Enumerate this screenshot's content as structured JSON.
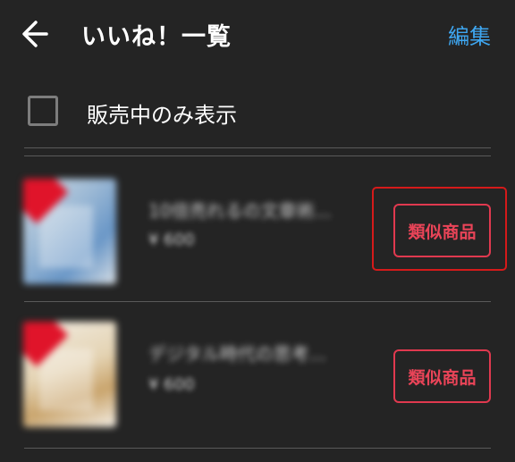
{
  "header": {
    "back_icon": "arrow-left-icon",
    "title": "いいね！一覧",
    "edit_label": "編集",
    "edit_color": "#3ea6f0"
  },
  "filter": {
    "checked": false,
    "label": "販売中のみ表示"
  },
  "items": [
    {
      "title": "10倍売れるの文章術...",
      "price": "¥ 600",
      "similar_label": "類似商品"
    },
    {
      "title": "デジタル時代の思考...",
      "price": "¥ 600",
      "similar_label": "類似商品"
    }
  ],
  "colors": {
    "background": "#242424",
    "accent_red": "#e0394f",
    "highlight_red": "#d51a1a",
    "divider": "#5a5a5a"
  }
}
